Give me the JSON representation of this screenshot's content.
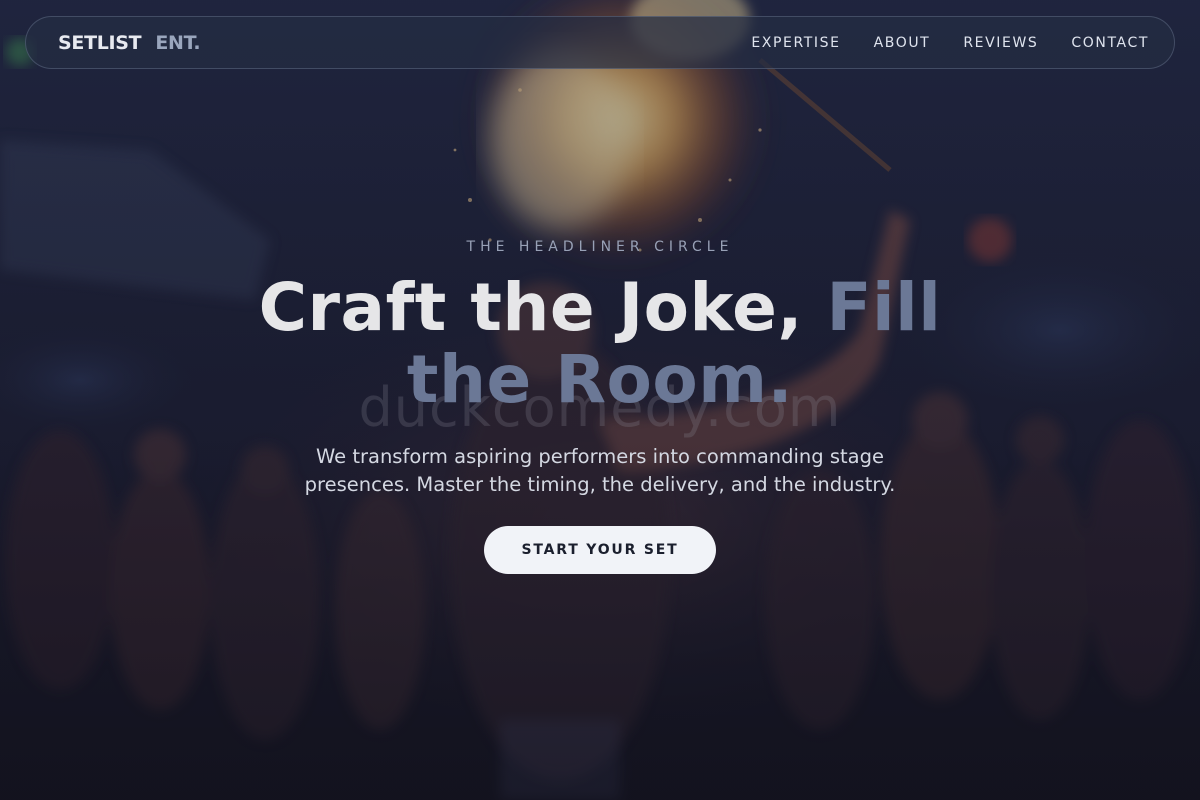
{
  "brand": {
    "name": "SETLIST",
    "suffix": "ENT."
  },
  "nav": {
    "links": [
      {
        "label": "EXPERTISE"
      },
      {
        "label": "ABOUT"
      },
      {
        "label": "REVIEWS"
      },
      {
        "label": "CONTACT"
      }
    ]
  },
  "hero": {
    "eyebrow": "THE HEADLINER CIRCLE",
    "headline_main": "Craft the Joke,",
    "headline_accent": "Fill the Room.",
    "watermark": "duckcomedy.com",
    "subtext": "We transform aspiring performers into commanding stage presences. Master the timing, the delivery, and the industry.",
    "cta_label": "START YOUR SET"
  },
  "colors": {
    "background": "#15172a",
    "headline": "#e6e6e8",
    "headline_accent": "#6b7896",
    "brand_accent": "#9aa6bd",
    "cta_background": "#f1f3f8",
    "cta_text": "#1b1f2e",
    "fire": "#f3b45a"
  }
}
